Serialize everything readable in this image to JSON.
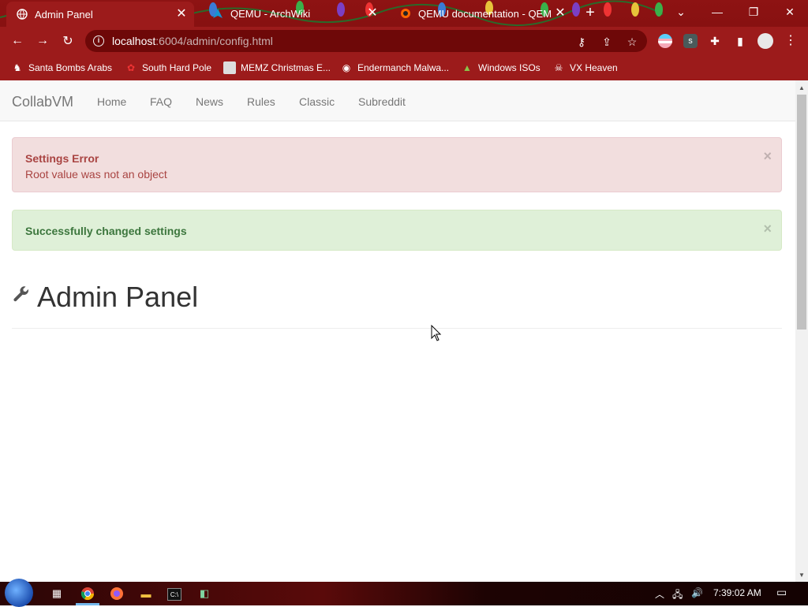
{
  "browser": {
    "tabs": [
      {
        "title": "Admin Panel",
        "active": true
      },
      {
        "title": "QEMU - ArchWiki",
        "active": false
      },
      {
        "title": "QEMU documentation - QEMU",
        "active": false
      }
    ],
    "url_host": "localhost",
    "url_rest": ":6004/admin/config.html",
    "bookmarks": [
      {
        "label": "Santa Bombs Arabs",
        "icon": "figure-icon"
      },
      {
        "label": "South Hard Pole",
        "icon": "raspberry-icon"
      },
      {
        "label": "MEMZ Christmas E...",
        "icon": "image-icon"
      },
      {
        "label": "Endermanch Malwa...",
        "icon": "raccoon-icon"
      },
      {
        "label": "Windows ISOs",
        "icon": "tree-icon"
      },
      {
        "label": "VX Heaven",
        "icon": "skull-icon"
      }
    ]
  },
  "navbar": {
    "brand": "CollabVM",
    "links": [
      "Home",
      "FAQ",
      "News",
      "Rules",
      "Classic",
      "Subreddit"
    ]
  },
  "alerts": {
    "error_title": "Settings Error",
    "error_message": "Root value was not an object",
    "success_message": "Successfully changed settings",
    "close_symbol": "×"
  },
  "page": {
    "heading": "Admin Panel",
    "heading_icon": "wrench-icon"
  },
  "taskbar": {
    "time": "7:39:02 AM"
  },
  "colors": {
    "chrome_red": "#9c1b1b",
    "danger_bg": "#f2dede",
    "success_bg": "#dff0d8"
  }
}
